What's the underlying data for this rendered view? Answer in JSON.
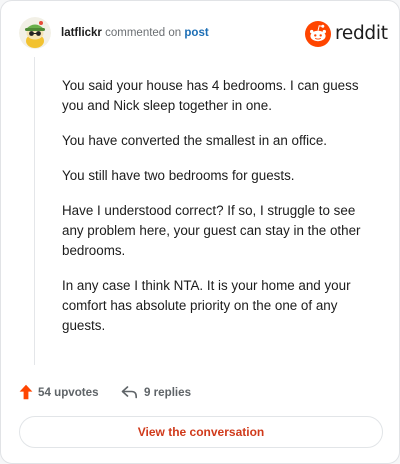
{
  "header": {
    "username": "latflickr",
    "action_text": "commented on",
    "target_text": "post",
    "logo_text": "reddit"
  },
  "comment": {
    "paragraphs": [
      "You said your house has 4 bedrooms. I can guess you and Nick sleep together in one.",
      "You have converted the smallest in an office.",
      "You still have two bedrooms for guests.",
      "Have I understood correct? If so, I struggle to see any problem here, your guest can stay in the other bedrooms.",
      "In any case I think NTA. It is your home and your comfort has absolute priority on the one of any guests."
    ]
  },
  "actions": {
    "upvotes_label": "54 upvotes",
    "replies_label": "9 replies"
  },
  "cta": {
    "label": "View the conversation"
  },
  "colors": {
    "brand": "#ff4500",
    "link": "#1c6eb5",
    "cta_text": "#d03a1b",
    "muted": "#6b6f73"
  },
  "icons": {
    "avatar": "snoo-avatar-green-hat",
    "upvote": "upvote-arrow-icon",
    "reply": "reply-arrow-icon",
    "logo": "reddit-snoo-logo"
  }
}
